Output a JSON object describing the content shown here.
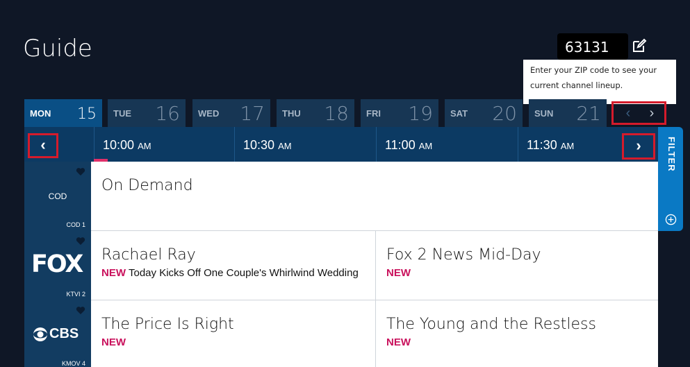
{
  "page": {
    "title": "Guide"
  },
  "zip": {
    "value": "63131",
    "tooltip_line1": "Enter your ZIP code to see your",
    "tooltip_line2": "current channel lineup."
  },
  "days": [
    {
      "name": "MON",
      "num": "15",
      "active": true
    },
    {
      "name": "TUE",
      "num": "16"
    },
    {
      "name": "WED",
      "num": "17"
    },
    {
      "name": "THU",
      "num": "18"
    },
    {
      "name": "FRI",
      "num": "19"
    },
    {
      "name": "SAT",
      "num": "20"
    },
    {
      "name": "SUN",
      "num": "21"
    }
  ],
  "week_nav": {
    "prev": "‹",
    "next": "›"
  },
  "time_nav": {
    "prev": "‹",
    "next": "›"
  },
  "times": [
    {
      "time": "10:00",
      "ampm": "AM"
    },
    {
      "time": "10:30",
      "ampm": "AM"
    },
    {
      "time": "11:00",
      "ampm": "AM"
    },
    {
      "time": "11:30",
      "ampm": "AM"
    }
  ],
  "filter": {
    "label": "FILTER"
  },
  "channels": [
    {
      "logo": "COD",
      "number": "COD 1",
      "programs": [
        {
          "title": "On Demand",
          "new": "",
          "desc": ""
        }
      ]
    },
    {
      "logo": "FOX",
      "number": "KTVI 2",
      "programs": [
        {
          "title": "Rachael Ray",
          "new": "NEW",
          "desc": "Today Kicks Off One Couple's Whirlwind Wedding"
        },
        {
          "title": "Fox 2 News Mid-Day",
          "new": "NEW",
          "desc": ""
        }
      ]
    },
    {
      "logo": "CBS",
      "number": "KMOV 4",
      "programs": [
        {
          "title": "The Price Is Right",
          "new": "NEW",
          "desc": ""
        },
        {
          "title": "The Young and the Restless",
          "new": "NEW",
          "desc": ""
        }
      ]
    }
  ],
  "colors": {
    "background": "#0f1726",
    "active_day": "#0a4f85",
    "highlight_box": "#d51b2b",
    "new_badge": "#c9115c",
    "filter_tab": "#0a79c4"
  }
}
